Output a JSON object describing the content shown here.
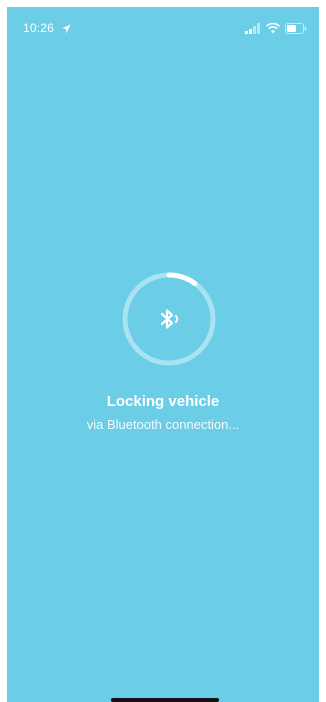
{
  "status_bar": {
    "time": "10:26",
    "icons": [
      "location-arrow-icon",
      "signal-icon",
      "wifi-icon",
      "battery-icon"
    ]
  },
  "progress": {
    "spinner_fraction": 0.1
  },
  "message": {
    "title": "Locking vehicle",
    "subtitle": "via Bluetooth connection..."
  },
  "colors": {
    "background": "#6bcde6",
    "text": "#ffffff",
    "ring_track": "#a9e3f1"
  }
}
